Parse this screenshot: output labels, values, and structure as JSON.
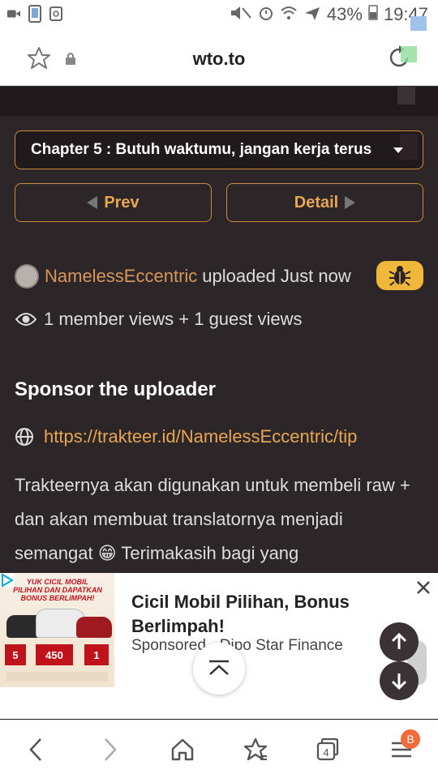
{
  "status_bar": {
    "battery_percent": "43%",
    "time": "19:47"
  },
  "browser": {
    "url": "wto.to"
  },
  "chapter_select": {
    "selected": "Chapter 5 : Butuh waktumu, jangan kerja terus"
  },
  "nav_buttons": {
    "prev_label": "Prev",
    "detail_label": "Detail"
  },
  "uploader": {
    "name": "NamelessEccentric",
    "uploaded_text": "uploaded Just now"
  },
  "views": {
    "text": "1 member views + 1 guest views"
  },
  "sponsor": {
    "title": "Sponsor the uploader",
    "link": "https://trakteer.id/NamelessEccentric/tip",
    "body": "Trakteernya akan digunakan untuk membeli raw + dan akan membuat translatornya menjadi semangat 😁 Terimakasih bagi yang"
  },
  "ad": {
    "title": "Cicil Mobil Pilihan, Bonus Berlimpah!",
    "sponsor_line": "Sponsored · Dipo Star Finance",
    "image_headline": "YUK CICIL MOBIL PILIHAN DAN DAPATKAN BONUS BERLIMPAH!",
    "price_left": "5",
    "price_mid": "450",
    "price_right": "1"
  },
  "bottom_nav": {
    "tab_count": "4",
    "menu_badge": "B"
  },
  "colors": {
    "accent": "#e8a653",
    "page_bg": "#2c2628",
    "bug_button": "#f0b83b"
  }
}
